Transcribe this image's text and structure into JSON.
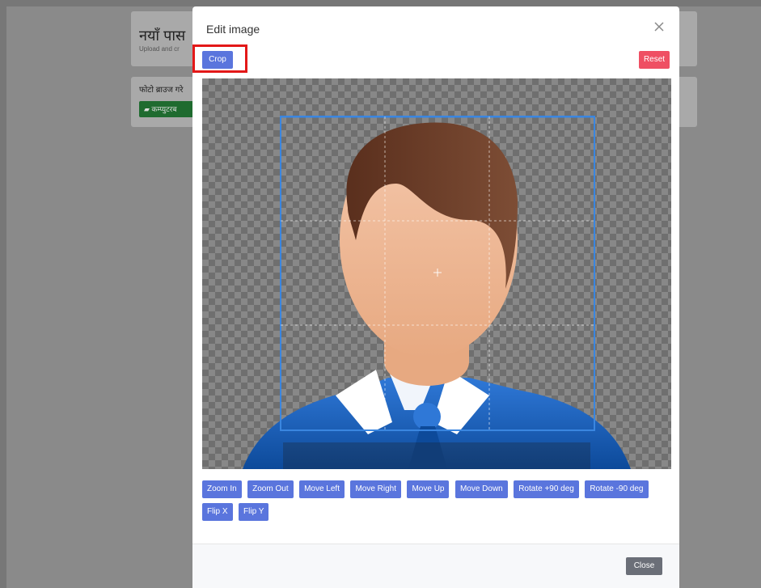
{
  "background": {
    "title": "नयाँ पास",
    "subtitle": "Upload and cr",
    "label": "फोटो ब्राउज गरे",
    "browse_button": "कम्प्युटरब"
  },
  "modal": {
    "title": "Edit image",
    "crop_label": "Crop",
    "reset_label": "Reset",
    "close_label": "Close",
    "tools": [
      "Zoom In",
      "Zoom Out",
      "Move Left",
      "Move Right",
      "Move Up",
      "Move Down",
      "Rotate +90 deg",
      "Rotate -90 deg",
      "Flip X",
      "Flip Y"
    ]
  },
  "colors": {
    "primary": "#5a75dd",
    "danger": "#ef4f63",
    "secondary": "#6b6f78",
    "highlight": "#e31818"
  }
}
